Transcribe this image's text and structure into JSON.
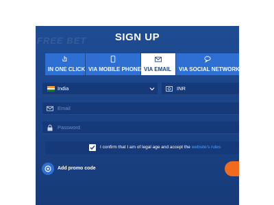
{
  "background_text": "FREE BET",
  "title": "SIGN UP",
  "tabs": [
    {
      "label": "IN ONE CLICK",
      "icon": "hand-pointer-icon",
      "active": false
    },
    {
      "label": "VIA MOBILE PHONE",
      "icon": "phone-icon",
      "active": false
    },
    {
      "label": "VIA EMAIL",
      "icon": "envelope-icon",
      "active": true
    },
    {
      "label": "VIA SOCIAL NETWORKS",
      "icon": "chat-bubbles-icon",
      "active": false
    }
  ],
  "form": {
    "country": "India",
    "currency": "INR",
    "email_placeholder": "Email",
    "password_placeholder": "Password",
    "confirm_text": "I confirm that I am of legal age and accept the",
    "rules_link": "website's rules",
    "promo_label": "Add promo code"
  },
  "colors": {
    "panel": "#1b4488",
    "tab": "#2d6fd3",
    "active_tab": "#ffffff",
    "field": "#16397a",
    "link": "#4ea0ff",
    "accent_button": "#f26a1b"
  }
}
